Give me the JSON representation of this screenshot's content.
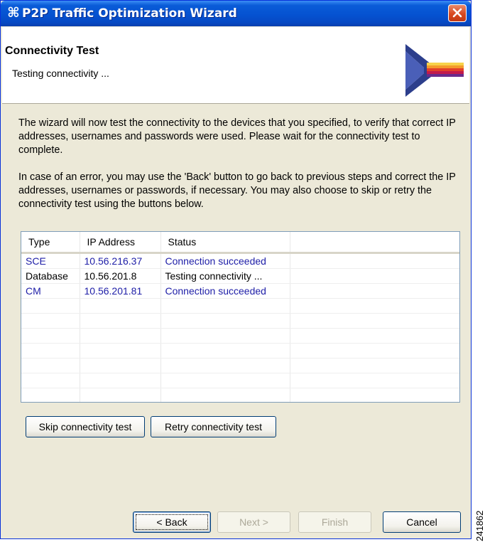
{
  "window": {
    "title": "P2P Traffic Optimization Wizard"
  },
  "banner": {
    "title": "Connectivity Test",
    "subtitle": "Testing connectivity ..."
  },
  "description": {
    "para1": "The wizard will now test the connectivity to the devices that you specified, to verify that correct IP addresses, usernames and passwords were used. Please wait for the connectivity test to complete.",
    "para2": "In case of an error, you may use the 'Back' button to go back to previous steps and correct the IP addresses, usernames or passwords, if necessary. You may also choose to skip or retry the connectivity test using the buttons below."
  },
  "table": {
    "columns": [
      "Type",
      "IP Address",
      "Status"
    ],
    "rows": [
      {
        "type": "SCE",
        "ip": "10.56.216.37",
        "status": "Connection succeeded"
      },
      {
        "type": "Database",
        "ip": "10.56.201.8",
        "status": "Testing connectivity ..."
      },
      {
        "type": "CM",
        "ip": "10.56.201.81",
        "status": "Connection succeeded"
      }
    ]
  },
  "buttons": {
    "skip": "Skip connectivity test",
    "retry": "Retry connectivity test",
    "back": "< Back",
    "next": "Next >",
    "finish": "Finish",
    "cancel": "Cancel"
  },
  "figure_id": "241862",
  "colors": {
    "title_bar": "#0552d1",
    "success_text": "#2020a8",
    "dialog_bg": "#ece9d8"
  }
}
